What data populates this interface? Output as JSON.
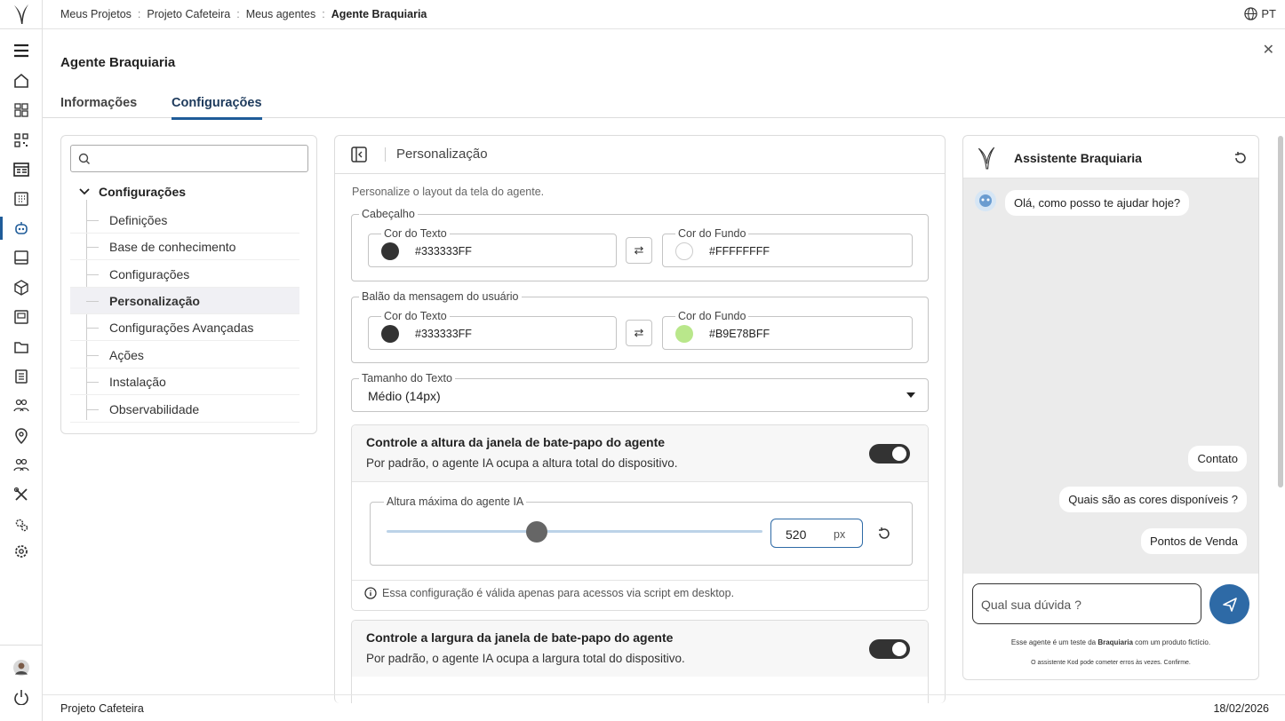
{
  "breadcrumb": {
    "items": [
      "Meus Projetos",
      "Projeto Cafeteira",
      "Meus agentes"
    ],
    "current": "Agente Braquiaria",
    "separator": ":"
  },
  "language": "PT",
  "page_title": "Agente Braquiaria",
  "tabs": [
    "Informações",
    "Configurações"
  ],
  "sidebar_nav": {
    "search_placeholder": "",
    "root": "Configurações",
    "items": [
      "Definições",
      "Base de conhecimento",
      "Configurações",
      "Personalização",
      "Configurações Avançadas",
      "Ações",
      "Instalação",
      "Observabilidade"
    ],
    "selected": "Personalização"
  },
  "panel": {
    "title": "Personalização",
    "description": "Personalize o layout da tela do agente.",
    "header_group": {
      "legend": "Cabeçalho",
      "text_color_label": "Cor do Texto",
      "text_color": "#333333FF",
      "bg_color_label": "Cor do Fundo",
      "bg_color": "#FFFFFFFF",
      "swap": "⇄"
    },
    "user_bubble_group": {
      "legend": "Balão da mensagem do usuário",
      "text_color_label": "Cor do Texto",
      "text_color": "#333333FF",
      "bg_color_label": "Cor do Fundo",
      "bg_color": "#B9E78BFF",
      "swap": "⇄"
    },
    "text_size": {
      "label": "Tamanho do Texto",
      "value": "Médio (14px)"
    },
    "height_control": {
      "title": "Controle a altura da janela de bate-papo do agente",
      "description": "Por padrão, o agente IA ocupa a altura total do dispositivo.",
      "enabled": true,
      "max_height_label": "Altura máxima do agente IA",
      "max_height_value": "520",
      "unit": "px",
      "slider_fraction": 0.4,
      "note": "Essa configuração é válida apenas para acessos via script em desktop."
    },
    "width_control": {
      "title": "Controle a largura da janela de bate-papo do agente",
      "description": "Por padrão, o agente IA ocupa a largura total do dispositivo.",
      "enabled": true
    }
  },
  "preview": {
    "title": "Assistente Braquiaria",
    "greeting": "Olá, como posso te ajudar hoje?",
    "suggestions": [
      "Contato",
      "Quais são as cores disponíveis ?",
      "Pontos de Venda"
    ],
    "input_placeholder": "Qual sua dúvida ?",
    "disclaimer_prefix": "Esse agente é um teste da ",
    "disclaimer_brand": "Braquiaria",
    "disclaimer_suffix": " com um produto fictício.",
    "disclaimer2": "O assistente Kod pode cometer erros às vezes. Confirme."
  },
  "footer": {
    "project": "Projeto Cafeteira",
    "date": "18/02/2026"
  },
  "colors": {
    "accent": "#1f5c99",
    "dark": "#333333",
    "user_bubble": "#B9E78B",
    "send_button": "#2e6aa6"
  }
}
